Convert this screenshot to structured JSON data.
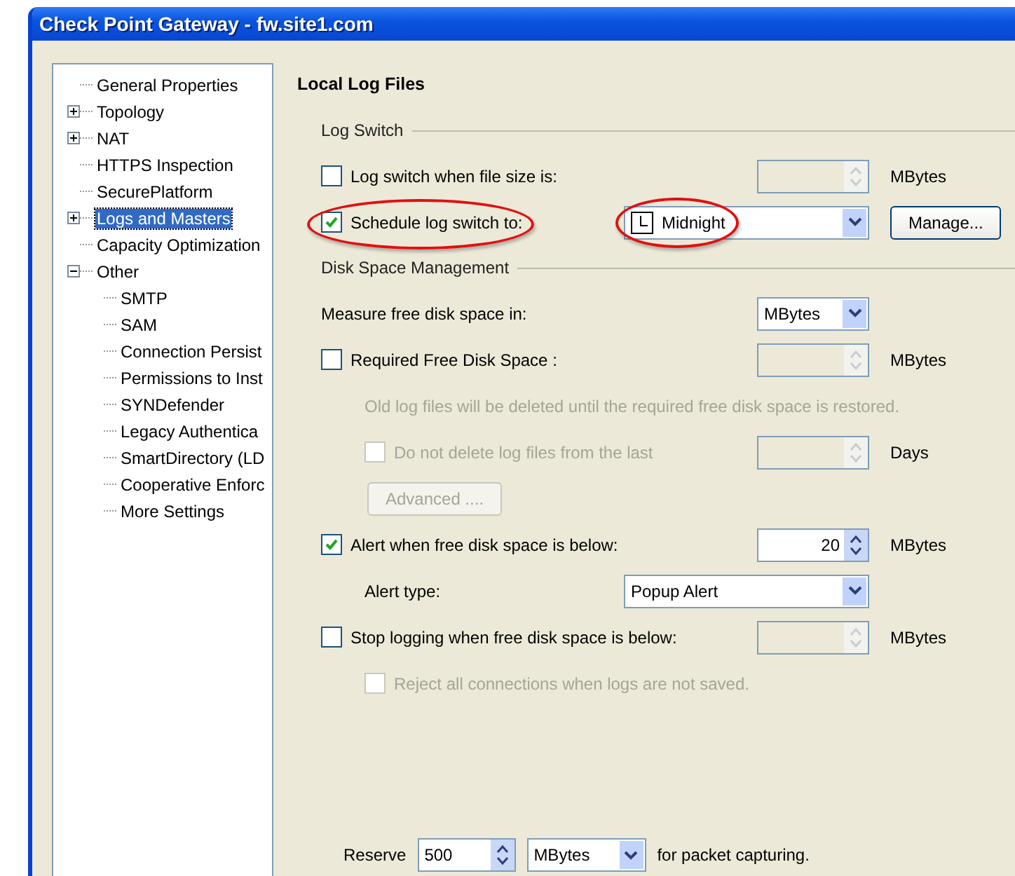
{
  "window": {
    "title": "Check Point Gateway - fw.site1.com"
  },
  "tree": [
    {
      "label": "General Properties",
      "kind": "leaf",
      "selected": false
    },
    {
      "label": "Topology",
      "kind": "folder",
      "expanded": false,
      "selected": false
    },
    {
      "label": "NAT",
      "kind": "folder",
      "expanded": false,
      "selected": false
    },
    {
      "label": "HTTPS Inspection",
      "kind": "leaf",
      "selected": false
    },
    {
      "label": "SecurePlatform",
      "kind": "leaf",
      "selected": false
    },
    {
      "label": "Logs and Masters",
      "kind": "folder",
      "expanded": false,
      "selected": true
    },
    {
      "label": "Capacity Optimization",
      "kind": "leaf",
      "selected": false
    },
    {
      "label": "Other",
      "kind": "folder",
      "expanded": true,
      "selected": false,
      "children": [
        {
          "label": "SMTP",
          "kind": "leaf",
          "selected": false
        },
        {
          "label": "SAM",
          "kind": "leaf",
          "selected": false
        },
        {
          "label": "Connection Persist",
          "kind": "leaf",
          "selected": false
        },
        {
          "label": "Permissions to Inst",
          "kind": "leaf",
          "selected": false
        },
        {
          "label": "SYNDefender",
          "kind": "leaf",
          "selected": false
        },
        {
          "label": "Legacy Authentica",
          "kind": "leaf",
          "selected": false
        },
        {
          "label": "SmartDirectory (LD",
          "kind": "leaf",
          "selected": false
        },
        {
          "label": "Cooperative Enforc",
          "kind": "leaf",
          "selected": false
        },
        {
          "label": "More Settings",
          "kind": "leaf",
          "selected": false
        }
      ]
    }
  ],
  "page_title": "Local Log Files",
  "sections": [
    {
      "title": "Log Switch",
      "rows": [
        {
          "kind": "checkbox-spin",
          "label": "Log switch when file size is:",
          "checked": false,
          "disabled": false,
          "enabled_field": false,
          "unit": "MBytes",
          "indent": false
        },
        {
          "kind": "checkbox-combo",
          "label": "Schedule log switch to:",
          "checked": true,
          "highlighted": true,
          "value": "Midnight",
          "button": "Manage..."
        }
      ]
    },
    {
      "title": "Disk Space Management",
      "rows": [
        {
          "kind": "label-combo",
          "label": "Measure free disk space in:",
          "value": "MBytes",
          "indent": false
        },
        {
          "kind": "checkbox-spin",
          "label": "Required Free Disk Space :",
          "checked": false,
          "disabled": false,
          "enabled_field": false,
          "unit": "MBytes",
          "indent": false
        },
        {
          "kind": "note",
          "text": "Old log files will be deleted until the required free disk space is restored."
        },
        {
          "kind": "checkbox-spin",
          "label": "Do not delete log files from the last",
          "checked": false,
          "disabled": true,
          "enabled_field": false,
          "unit": "Days",
          "indent": true
        },
        {
          "kind": "button",
          "label": "Advanced ....",
          "disabled": true
        },
        {
          "kind": "checkbox-spin",
          "label": "Alert when free disk space is below:",
          "checked": true,
          "disabled": false,
          "enabled_field": true,
          "value": "20",
          "unit": "MBytes",
          "indent": false
        },
        {
          "kind": "label-combo",
          "label": "Alert type:",
          "value": "Popup Alert",
          "indent": true
        },
        {
          "kind": "checkbox-spin",
          "label": "Stop logging when free disk space is below:",
          "checked": false,
          "disabled": false,
          "enabled_field": false,
          "unit": "MBytes",
          "indent": false
        },
        {
          "kind": "checkbox",
          "label": "Reject all connections when logs are not saved.",
          "checked": false,
          "disabled": true
        }
      ]
    }
  ],
  "reserve": {
    "label": "Reserve",
    "value": "500",
    "unit": "MBytes",
    "suffix": "for packet capturing."
  }
}
